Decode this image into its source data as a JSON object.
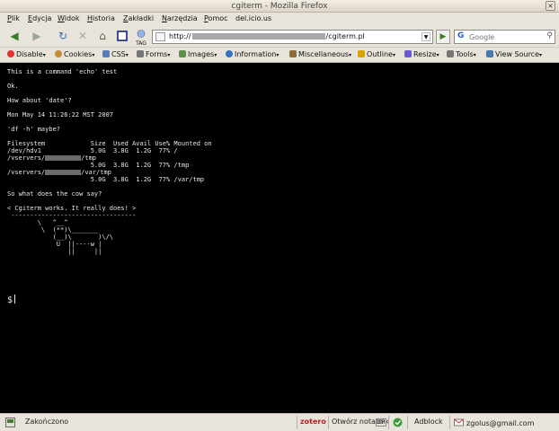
{
  "window": {
    "title": "cgiterm - Mozilla Firefox",
    "close_glyph": "×"
  },
  "menu": [
    {
      "label": "Plik",
      "key": "P",
      "rest": "lik"
    },
    {
      "label": "Edycja",
      "key": "E",
      "rest": "dycja"
    },
    {
      "label": "Widok",
      "key": "W",
      "rest": "idok"
    },
    {
      "label": "Historia",
      "key": "H",
      "rest": "istoria"
    },
    {
      "label": "Zakładki",
      "key": "Z",
      "rest": "akładki"
    },
    {
      "label": "Narzędzia",
      "key": "N",
      "rest": "arzędzia"
    },
    {
      "label": "Pomoc",
      "key": "P",
      "rest": "omoc"
    },
    {
      "label": "del.icio.us",
      "key": "",
      "rest": "del.icio.us"
    }
  ],
  "nav": {
    "back_glyph": "◀",
    "forward_glyph": "▶",
    "reload_glyph": "↻",
    "stop_glyph": "✕",
    "home_glyph": "⌂",
    "tag_label": "TAG",
    "url_prefix": "http://",
    "url_suffix": "/cgiterm.pl",
    "go_glyph": "▶",
    "search_placeholder": "Google",
    "search_engine_glyph": "G",
    "search_glyph": "⚲"
  },
  "devbar": [
    {
      "label": "Disable",
      "icon_color": "#d33"
    },
    {
      "label": "Cookies",
      "icon_color": "#c58a35"
    },
    {
      "label": "CSS",
      "icon_color": "#5a7ab8"
    },
    {
      "label": "Forms",
      "icon_color": "#777"
    },
    {
      "label": "Images",
      "icon_color": "#5f8f4e"
    },
    {
      "label": "Information",
      "icon_color": "#3a6fc4"
    },
    {
      "label": "Miscellaneous",
      "icon_color": "#8a6d3b"
    },
    {
      "label": "Outline",
      "icon_color": "#d8a300"
    },
    {
      "label": "Resize",
      "icon_color": "#6a5acd"
    },
    {
      "label": "Tools",
      "icon_color": "#777"
    },
    {
      "label": "View Source",
      "icon_color": "#4a78b0"
    }
  ],
  "terminal": {
    "line1": "This is a command 'echo' test",
    "line2": "Ok.",
    "line3": "How about 'date'?",
    "line4": "Mon May 14 11:26:22 MST 2007",
    "line5": "'df -h' maybe?",
    "df_header": "Filesystem            Size  Used Avail Use% Mounted on",
    "df_row1": "/dev/hdv1             5.0G  3.8G  1.2G  77% /",
    "df_row2a": "/vservers/",
    "df_row2b": "/tmp",
    "df_row2c": "                      5.0G  3.8G  1.2G  77% /tmp",
    "df_row3a": "/vservers/",
    "df_row3b": "/var/tmp",
    "df_row3c": "                      5.0G  3.8G  1.2G  77% /var/tmp",
    "line6": "So what does the cow say?",
    "cow": "< Cgiterm works. It really does! >\n ---------------------------------\n        \\   ^__^\n         \\  (**)\\_______\n            (__)\\       )\\/\\\n             U  ||----w |\n                ||     ||",
    "prompt": "$"
  },
  "status": {
    "done": "Zakończono",
    "zotero": "zotero",
    "notebook": "Otwórz notatnik",
    "gp": "GP",
    "adblock": "Adblock",
    "mail": "zgolus@gmail.com"
  }
}
